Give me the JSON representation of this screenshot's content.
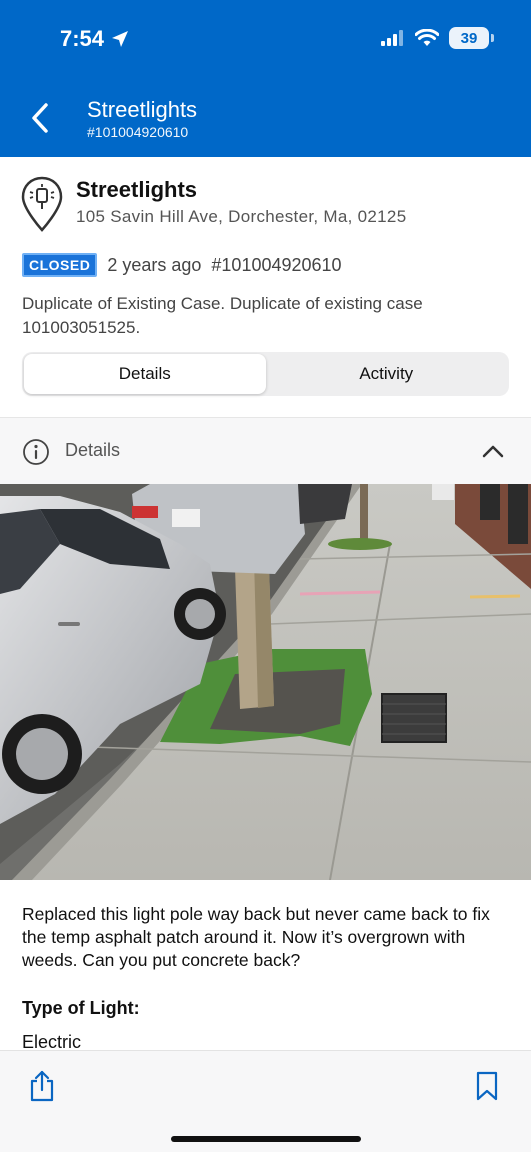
{
  "status_bar": {
    "time": "7:54",
    "battery": "39"
  },
  "header": {
    "title": "Streetlights",
    "subtitle": "#101004920610"
  },
  "case": {
    "title": "Streetlights",
    "address": "105 Savin Hill Ave, Dorchester, Ma, 02125",
    "status": "CLOSED",
    "age": "2 years ago",
    "number": "#101004920610",
    "resolution": "Duplicate of Existing Case. Duplicate of existing case 101003051525."
  },
  "tabs": [
    {
      "label": "Details",
      "active": true
    },
    {
      "label": "Activity",
      "active": false
    }
  ],
  "details": {
    "section_label": "Details",
    "description": "Replaced this light pole way back but never came back to fix the temp asphalt patch around it. Now it’s overgrown with weeds. Can you put concrete back?",
    "fields": [
      {
        "label": "Type of Light:",
        "value": "Electric"
      }
    ]
  },
  "colors": {
    "brand": "#0068C8",
    "badge": "#1a73d9",
    "accent": "#0a66c2"
  },
  "icons": [
    "location-arrow-icon",
    "signal-icon",
    "wifi-icon",
    "back-chevron-icon",
    "streetlight-pin-icon",
    "info-icon",
    "chevron-up-icon",
    "share-icon",
    "bookmark-icon"
  ]
}
